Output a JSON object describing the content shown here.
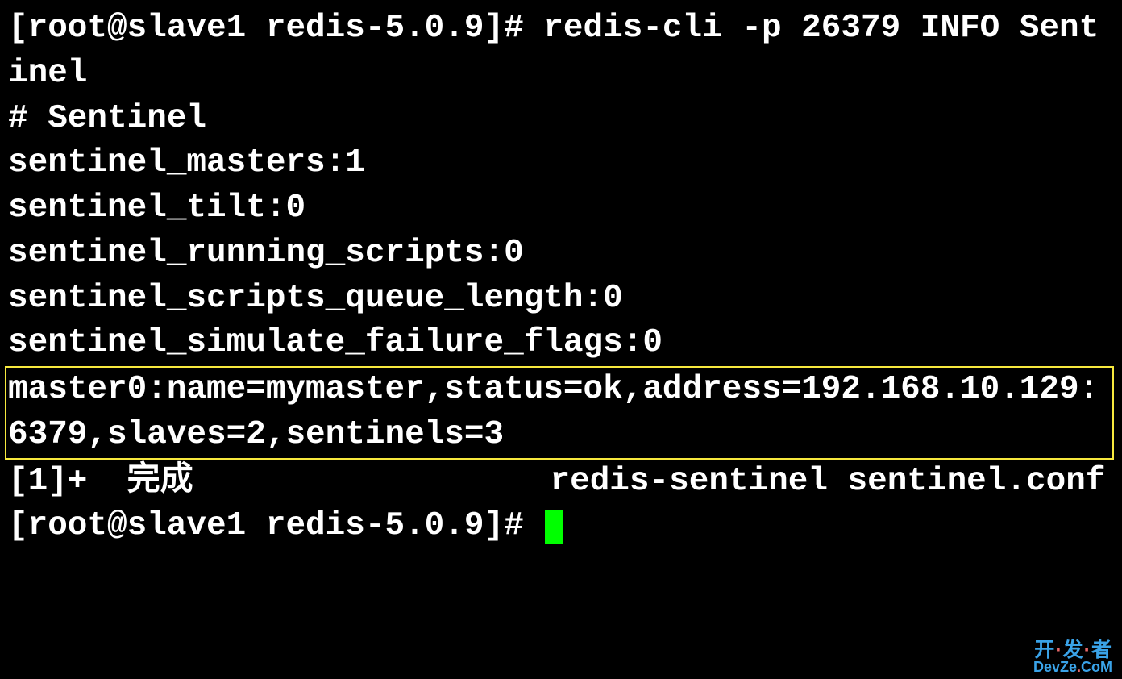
{
  "terminal": {
    "prompt1": "[root@slave1 redis-5.0.9]# ",
    "command1": "redis-cli -p 26379 INFO Sentinel",
    "output": {
      "header": "# Sentinel",
      "sentinel_masters": "sentinel_masters:1",
      "sentinel_tilt": "sentinel_tilt:0",
      "sentinel_running_scripts": "sentinel_running_scripts:0",
      "sentinel_scripts_queue_length": "sentinel_scripts_queue_length:0",
      "sentinel_simulate_failure_flags": "sentinel_simulate_failure_flags:0",
      "master0": "master0:name=mymaster,status=ok,address=192.168.10.129:6379,slaves=2,sentinels=3"
    },
    "job_done": "[1]+  完成                  redis-sentinel sentinel.conf",
    "prompt2": "[root@slave1 redis-5.0.9]# "
  },
  "watermark": {
    "line1_pre": "开",
    "line1_dot": "·",
    "line1_post": "发",
    "line1_end": "者",
    "line2_pre": "DevZe",
    "line2_dot": ".",
    "line2_post": "CoM"
  }
}
